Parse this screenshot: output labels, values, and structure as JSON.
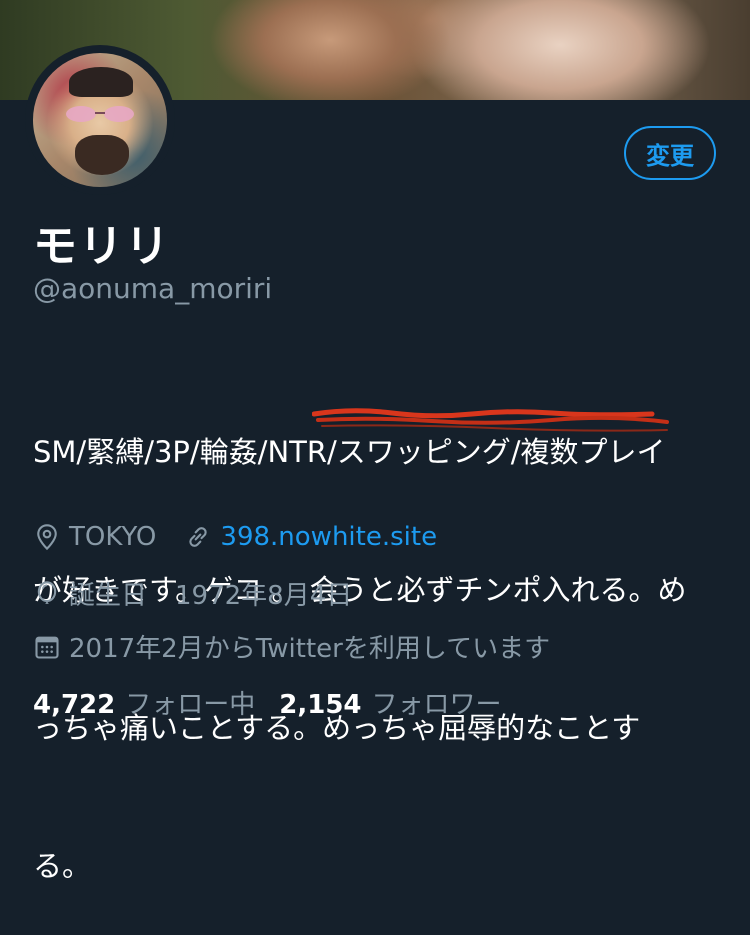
{
  "profile": {
    "name": "モリリ",
    "handle": "@aonuma_moriri",
    "edit_button_label": "変更",
    "bio_lines": [
      "SM/緊縛/3P/輪姦/NTR/スワッピング/複数プレイ",
      "が好きです。ゲコ 。 会うと必ずチンポ入れる。め",
      "っちゃ痛いことする。めっちゃ屈辱的なことす",
      "る。"
    ],
    "location": "TOKYO",
    "website": "398.nowhite.site",
    "birthday_label": "誕生日",
    "birthday": "1972年8月4日",
    "joined": "2017年2月からTwitterを利用しています",
    "following_count": "4,722",
    "following_label": "フォロー中",
    "followers_count": "2,154",
    "followers_label": "フォロワー"
  },
  "colors": {
    "background": "#15202b",
    "accent": "#1d9bf0",
    "secondary_text": "#8899a6",
    "scribble": "#d9361c"
  },
  "icons": [
    "location-pin-icon",
    "link-icon",
    "balloon-icon",
    "calendar-icon"
  ]
}
